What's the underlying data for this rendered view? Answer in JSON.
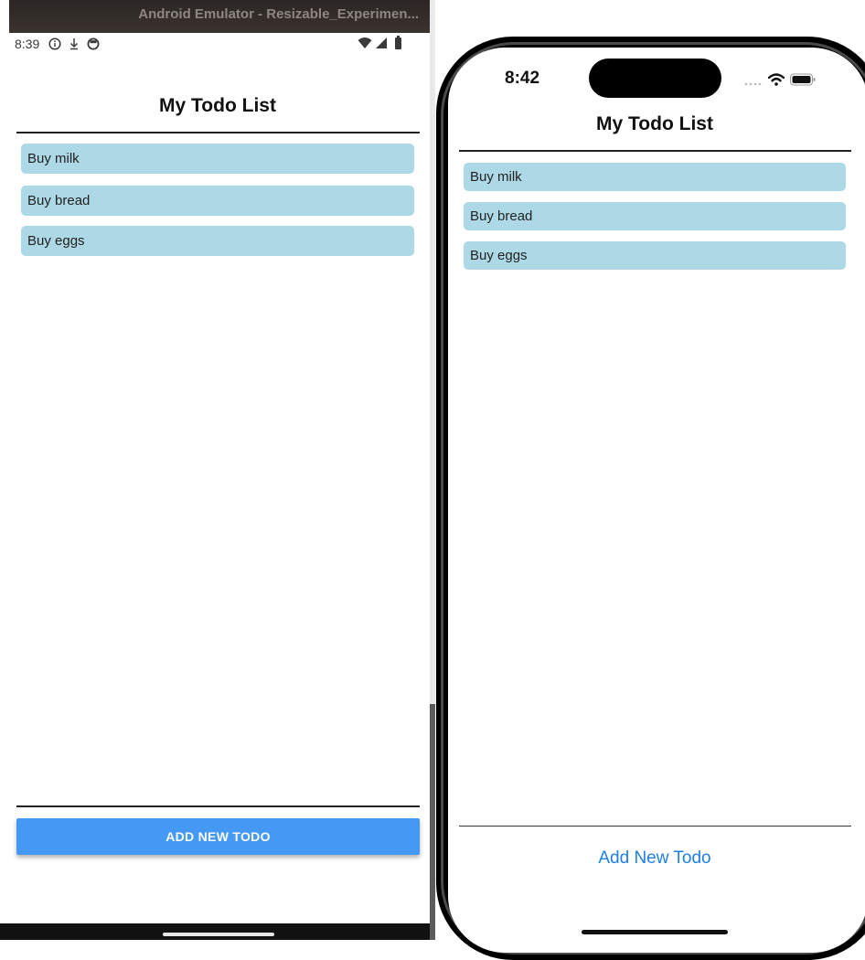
{
  "android": {
    "window_title": "Android Emulator - Resizable_Experimen...",
    "status_time": "8:39",
    "status_icons": [
      "info-icon",
      "download-icon",
      "sync-icon",
      "wifi-icon",
      "signal-icon",
      "battery-icon"
    ],
    "screen_title": "My Todo List",
    "todos": [
      "Buy milk",
      "Buy bread",
      "Buy eggs"
    ],
    "add_button_label": "ADD NEW TODO",
    "accent_color": "#4399f3",
    "item_color": "#add8e6"
  },
  "iphone": {
    "status_time": "8:42",
    "status_icons": [
      "cellular-dots-icon",
      "wifi-icon",
      "battery-icon"
    ],
    "screen_title": "My Todo List",
    "todos": [
      "Buy milk",
      "Buy bread",
      "Buy eggs"
    ],
    "add_button_label": "Add New Todo",
    "link_color": "#1e7fe6",
    "item_color": "#add8e6"
  }
}
